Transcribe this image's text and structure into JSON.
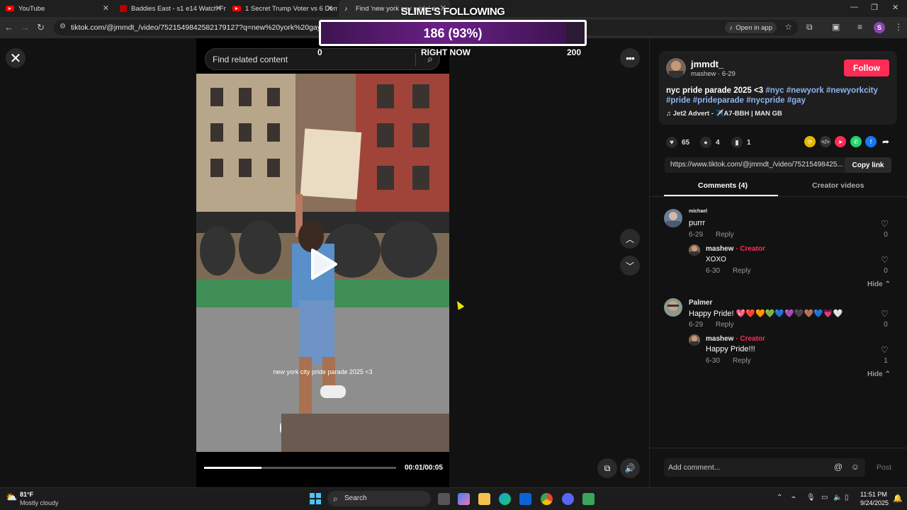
{
  "browser": {
    "tabs": [
      {
        "title": "YouTube",
        "icon": "youtube-icon"
      },
      {
        "title": "Baddies East - s1 e14 Watch Fr",
        "icon": "netflix-icon"
      },
      {
        "title": "1 Secret Trump Voter vs 6 Dem",
        "icon": "youtube-icon"
      },
      {
        "title": "Find 'new york gay pride' on ...",
        "icon": "tiktok-icon"
      }
    ],
    "url": "tiktok.com/@jmmdt_/video/7521549842582179127?q=new%20york%20gay%20pride...",
    "open_in_app": "Open in app",
    "profile_initial": "S"
  },
  "overlay": {
    "title": "SLIME'S FOLLOWING",
    "value_text": "186 (93%)",
    "progress": 0.93,
    "min_label": "0",
    "right_now": "RIGHT NOW",
    "max_label": "200"
  },
  "video": {
    "search_placeholder": "Find related content",
    "caption": "new york city pride parade 2025 <3",
    "time": "00:01/00:05",
    "progress": 0.3
  },
  "author": {
    "username": "jmmdt_",
    "sub": "mashew · 6-29",
    "follow_label": "Follow",
    "desc_text": "nyc pride parade 2025 <3",
    "hashtags": [
      "#nyc",
      "#newyork",
      "#newyorkcity",
      "#pride",
      "#prideparade",
      "#nycpride",
      "#gay"
    ],
    "music": "Jet2 Advert - ✈️A7-BBH | MAN GB"
  },
  "stats": {
    "likes": "65",
    "comments": "4",
    "saves": "1"
  },
  "share": {
    "link": "https://www.tiktok.com/@jmmdt_/video/75215498425...",
    "copy_label": "Copy link"
  },
  "panel_tabs": {
    "comments": "Comments (4)",
    "creator_videos": "Creator videos"
  },
  "comments": [
    {
      "user": "michael",
      "text": "purrr",
      "date": "6-29",
      "reply": "Reply",
      "likes": "0",
      "reply_item": {
        "user": "mashew",
        "badge": "· Creator",
        "text": "XOXO",
        "date": "6-30",
        "reply": "Reply",
        "likes": "0"
      },
      "hide": "Hide"
    },
    {
      "user": "Palmer",
      "text": "Happy Pride! 💖❤️🧡💚💙💜🖤🤎💙💗🤍",
      "date": "6-29",
      "reply": "Reply",
      "likes": "0",
      "reply_item": {
        "user": "mashew",
        "badge": "· Creator",
        "text": "Happy Pride!!!",
        "date": "6-30",
        "reply": "Reply",
        "likes": "1"
      },
      "hide": "Hide"
    }
  ],
  "add_comment": {
    "placeholder": "Add comment...",
    "post_label": "Post"
  },
  "taskbar": {
    "weather_temp": "81°F",
    "weather_desc": "Mostly cloudy",
    "search": "Search",
    "time": "11:51 PM",
    "date": "9/24/2025"
  }
}
